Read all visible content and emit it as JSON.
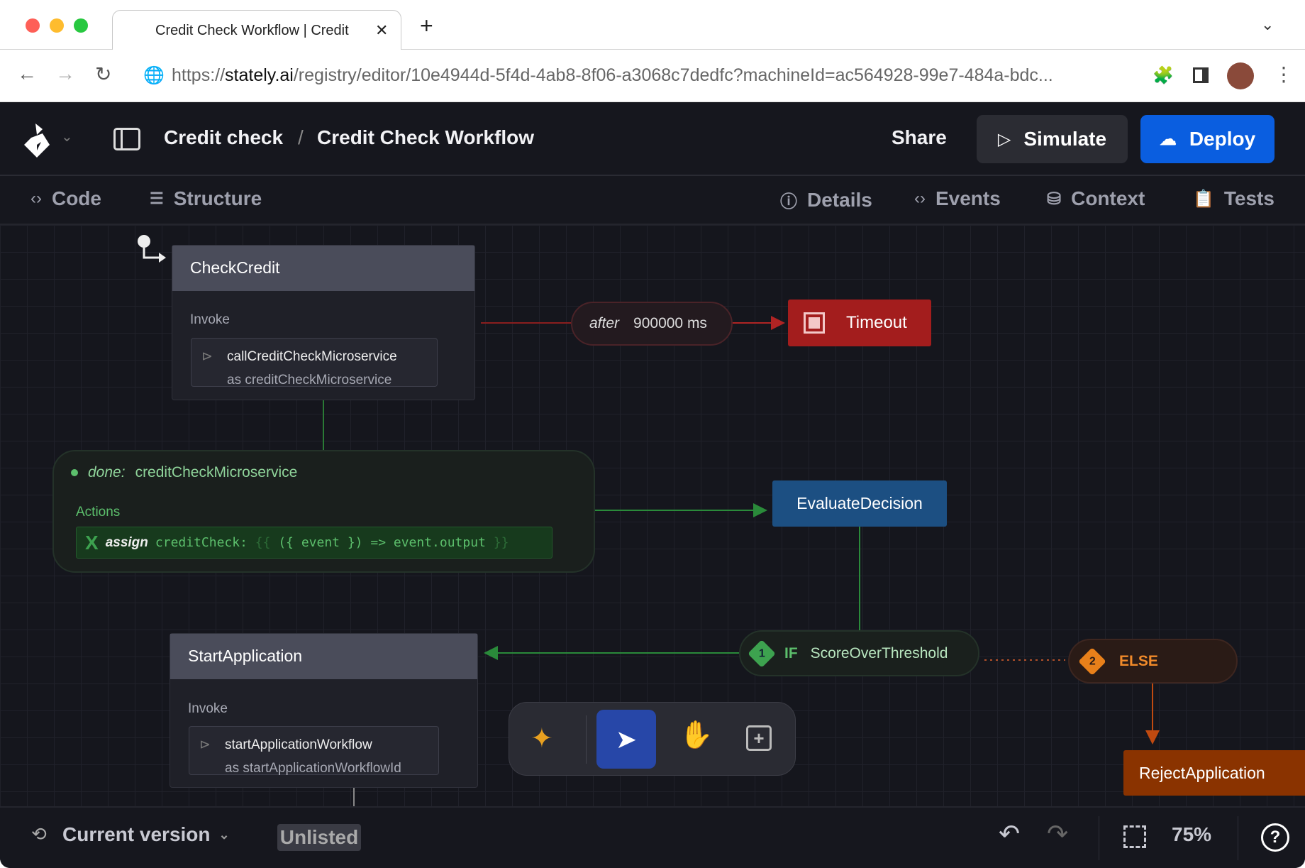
{
  "browser": {
    "tab_title": "Credit Check Workflow | Credit",
    "url_prefix": "https://",
    "url_domain": "stately.ai",
    "url_path": "/registry/editor/10e4944d-5f4d-4ab8-8f06-a3068c7dedfc?machineId=ac564928-99e7-484a-bdc..."
  },
  "header": {
    "project": "Credit check",
    "separator": "/",
    "machine": "Credit Check Workflow",
    "share": "Share",
    "simulate": "Simulate",
    "deploy": "Deploy"
  },
  "subbar": {
    "code": "Code",
    "structure": "Structure",
    "details": "Details",
    "events": "Events",
    "context": "Context",
    "tests": "Tests"
  },
  "nodes": {
    "check_credit": {
      "title": "CheckCredit",
      "invoke_label": "Invoke",
      "service": "callCreditCheckMicroservice",
      "alias": "as creditCheckMicroservice"
    },
    "after": {
      "keyword": "after",
      "value": "900000 ms"
    },
    "timeout": {
      "title": "Timeout"
    },
    "done": {
      "keyword": "done:",
      "event": "creditCheckMicroservice",
      "actions_label": "Actions",
      "action_keyword": "assign",
      "action_code": "creditCheck:",
      "action_open": "{{",
      "action_expr": "({ event }) => event.output",
      "action_close": "}}"
    },
    "evaluate": {
      "title": "EvaluateDecision"
    },
    "if_guard": {
      "index": "1",
      "keyword": "IF",
      "guard": "ScoreOverThreshold"
    },
    "else_guard": {
      "index": "2",
      "keyword": "ELSE"
    },
    "reject": {
      "title": "RejectApplication"
    },
    "start_app": {
      "title": "StartApplication",
      "invoke_label": "Invoke",
      "service": "startApplicationWorkflow",
      "alias": "as startApplicationWorkflowId"
    }
  },
  "bottom": {
    "version": "Current version",
    "visibility": "Unlisted",
    "zoom": "75%"
  },
  "colors": {
    "deploy": "#0a5ee0",
    "timeout": "#a31d1d",
    "evaluate": "#1c4f82",
    "reject": "#8a3300",
    "green": "#3da24f",
    "orange": "#e8801a"
  }
}
